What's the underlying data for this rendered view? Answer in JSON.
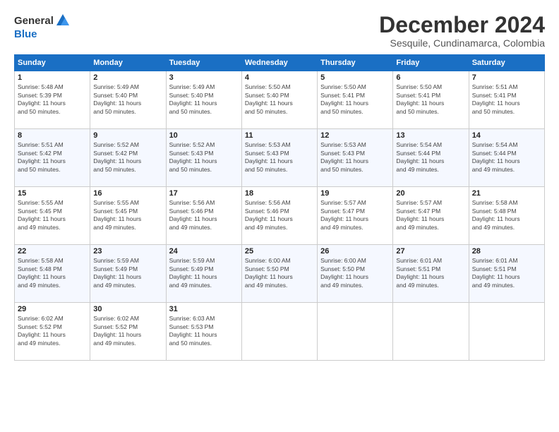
{
  "logo": {
    "general": "General",
    "blue": "Blue"
  },
  "title": "December 2024",
  "subtitle": "Sesquile, Cundinamarca, Colombia",
  "headers": [
    "Sunday",
    "Monday",
    "Tuesday",
    "Wednesday",
    "Thursday",
    "Friday",
    "Saturday"
  ],
  "weeks": [
    [
      {
        "day": "1",
        "info": "Sunrise: 5:48 AM\nSunset: 5:39 PM\nDaylight: 11 hours\nand 50 minutes."
      },
      {
        "day": "2",
        "info": "Sunrise: 5:49 AM\nSunset: 5:40 PM\nDaylight: 11 hours\nand 50 minutes."
      },
      {
        "day": "3",
        "info": "Sunrise: 5:49 AM\nSunset: 5:40 PM\nDaylight: 11 hours\nand 50 minutes."
      },
      {
        "day": "4",
        "info": "Sunrise: 5:50 AM\nSunset: 5:40 PM\nDaylight: 11 hours\nand 50 minutes."
      },
      {
        "day": "5",
        "info": "Sunrise: 5:50 AM\nSunset: 5:41 PM\nDaylight: 11 hours\nand 50 minutes."
      },
      {
        "day": "6",
        "info": "Sunrise: 5:50 AM\nSunset: 5:41 PM\nDaylight: 11 hours\nand 50 minutes."
      },
      {
        "day": "7",
        "info": "Sunrise: 5:51 AM\nSunset: 5:41 PM\nDaylight: 11 hours\nand 50 minutes."
      }
    ],
    [
      {
        "day": "8",
        "info": "Sunrise: 5:51 AM\nSunset: 5:42 PM\nDaylight: 11 hours\nand 50 minutes."
      },
      {
        "day": "9",
        "info": "Sunrise: 5:52 AM\nSunset: 5:42 PM\nDaylight: 11 hours\nand 50 minutes."
      },
      {
        "day": "10",
        "info": "Sunrise: 5:52 AM\nSunset: 5:43 PM\nDaylight: 11 hours\nand 50 minutes."
      },
      {
        "day": "11",
        "info": "Sunrise: 5:53 AM\nSunset: 5:43 PM\nDaylight: 11 hours\nand 50 minutes."
      },
      {
        "day": "12",
        "info": "Sunrise: 5:53 AM\nSunset: 5:43 PM\nDaylight: 11 hours\nand 50 minutes."
      },
      {
        "day": "13",
        "info": "Sunrise: 5:54 AM\nSunset: 5:44 PM\nDaylight: 11 hours\nand 49 minutes."
      },
      {
        "day": "14",
        "info": "Sunrise: 5:54 AM\nSunset: 5:44 PM\nDaylight: 11 hours\nand 49 minutes."
      }
    ],
    [
      {
        "day": "15",
        "info": "Sunrise: 5:55 AM\nSunset: 5:45 PM\nDaylight: 11 hours\nand 49 minutes."
      },
      {
        "day": "16",
        "info": "Sunrise: 5:55 AM\nSunset: 5:45 PM\nDaylight: 11 hours\nand 49 minutes."
      },
      {
        "day": "17",
        "info": "Sunrise: 5:56 AM\nSunset: 5:46 PM\nDaylight: 11 hours\nand 49 minutes."
      },
      {
        "day": "18",
        "info": "Sunrise: 5:56 AM\nSunset: 5:46 PM\nDaylight: 11 hours\nand 49 minutes."
      },
      {
        "day": "19",
        "info": "Sunrise: 5:57 AM\nSunset: 5:47 PM\nDaylight: 11 hours\nand 49 minutes."
      },
      {
        "day": "20",
        "info": "Sunrise: 5:57 AM\nSunset: 5:47 PM\nDaylight: 11 hours\nand 49 minutes."
      },
      {
        "day": "21",
        "info": "Sunrise: 5:58 AM\nSunset: 5:48 PM\nDaylight: 11 hours\nand 49 minutes."
      }
    ],
    [
      {
        "day": "22",
        "info": "Sunrise: 5:58 AM\nSunset: 5:48 PM\nDaylight: 11 hours\nand 49 minutes."
      },
      {
        "day": "23",
        "info": "Sunrise: 5:59 AM\nSunset: 5:49 PM\nDaylight: 11 hours\nand 49 minutes."
      },
      {
        "day": "24",
        "info": "Sunrise: 5:59 AM\nSunset: 5:49 PM\nDaylight: 11 hours\nand 49 minutes."
      },
      {
        "day": "25",
        "info": "Sunrise: 6:00 AM\nSunset: 5:50 PM\nDaylight: 11 hours\nand 49 minutes."
      },
      {
        "day": "26",
        "info": "Sunrise: 6:00 AM\nSunset: 5:50 PM\nDaylight: 11 hours\nand 49 minutes."
      },
      {
        "day": "27",
        "info": "Sunrise: 6:01 AM\nSunset: 5:51 PM\nDaylight: 11 hours\nand 49 minutes."
      },
      {
        "day": "28",
        "info": "Sunrise: 6:01 AM\nSunset: 5:51 PM\nDaylight: 11 hours\nand 49 minutes."
      }
    ],
    [
      {
        "day": "29",
        "info": "Sunrise: 6:02 AM\nSunset: 5:52 PM\nDaylight: 11 hours\nand 49 minutes."
      },
      {
        "day": "30",
        "info": "Sunrise: 6:02 AM\nSunset: 5:52 PM\nDaylight: 11 hours\nand 49 minutes."
      },
      {
        "day": "31",
        "info": "Sunrise: 6:03 AM\nSunset: 5:53 PM\nDaylight: 11 hours\nand 50 minutes."
      },
      {
        "day": "",
        "info": ""
      },
      {
        "day": "",
        "info": ""
      },
      {
        "day": "",
        "info": ""
      },
      {
        "day": "",
        "info": ""
      }
    ]
  ]
}
